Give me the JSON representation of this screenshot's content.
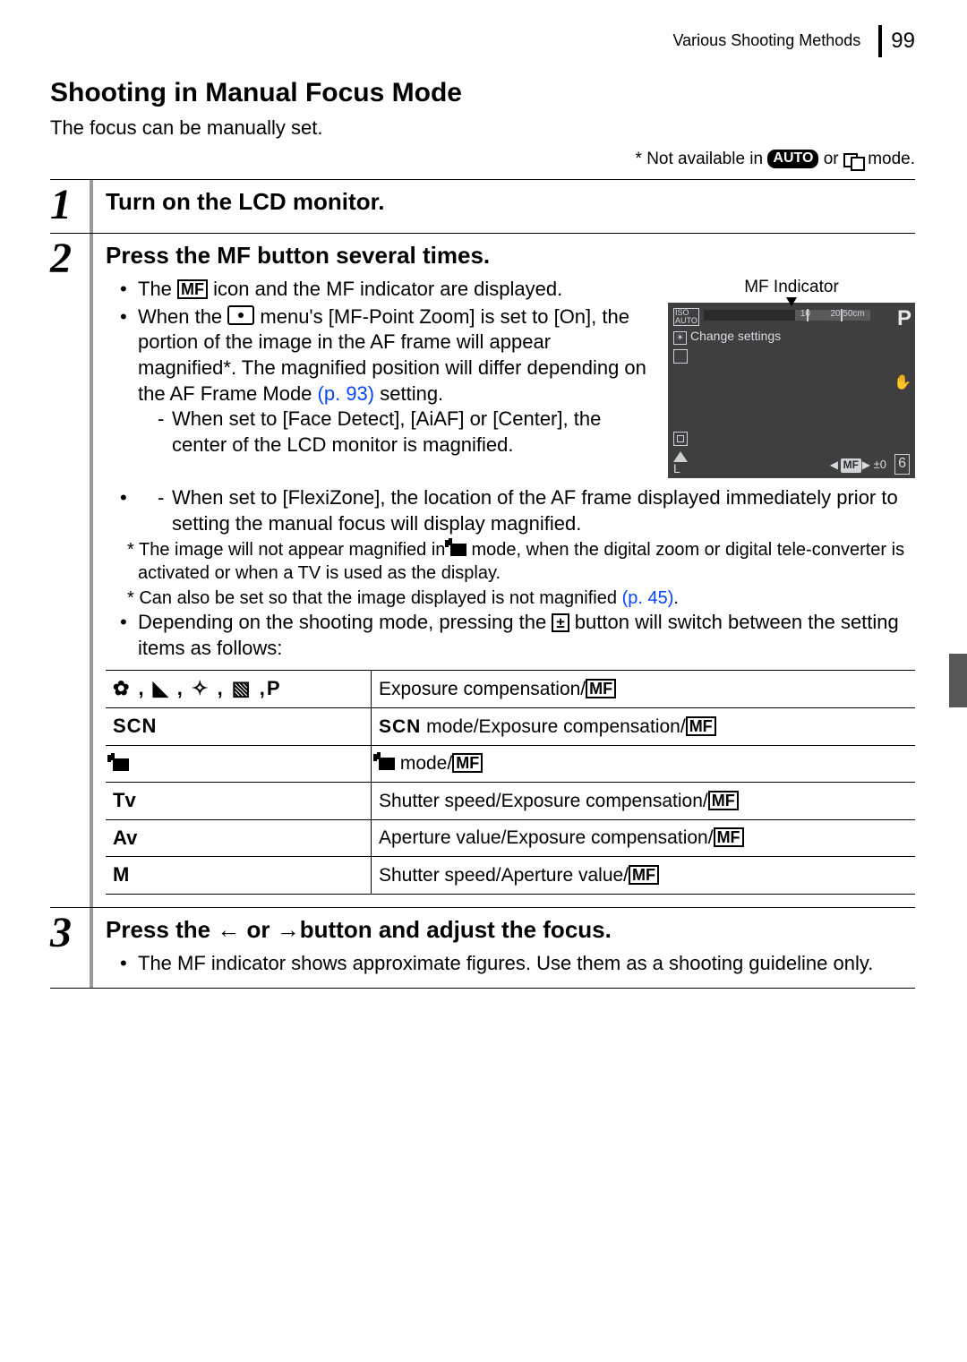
{
  "header": {
    "section": "Various Shooting Methods",
    "page": "99"
  },
  "title": "Shooting in Manual Focus Mode",
  "intro": "The focus can be manually set.",
  "availability": {
    "prefix": "* Not available in ",
    "mid": " or ",
    "suffix": " mode.",
    "auto_badge": "AUTO"
  },
  "step1": {
    "heading": "Turn on the LCD monitor."
  },
  "step2": {
    "heading_pre": "Press the ",
    "heading_mf": "MF",
    "heading_post": " button several times.",
    "b1a": "The ",
    "b1b": " icon and the MF indicator are displayed.",
    "b2a": "When the ",
    "b2b": " menu's [MF-Point Zoom] is set to [On], the portion of the image in the AF frame will appear magnified*. The magnified position will differ depending on the AF Frame Mode ",
    "b2link": "(p. 93)",
    "b2c": " setting.",
    "d1": "When set to [Face Detect], [AiAF] or [Center], the center of the LCD monitor is magnified.",
    "d2": "When set to [FlexiZone], the location of the AF frame displayed immediately prior to setting the manual focus will display magnified.",
    "f1a": "* The image will not appear magnified in ",
    "f1b": " mode, when the digital zoom or digital tele-converter is activated or when a TV is used as the display.",
    "f2a": "* Can also be set so that the image displayed is not magnified ",
    "f2link": "(p. 45)",
    "f2b": ".",
    "b3a": "Depending on the shooting mode, pressing the ",
    "b3b": " button will switch between the setting items as follows:",
    "table": [
      {
        "mode_icons": "creative",
        "desc": "Exposure compensation/",
        "mf": true
      },
      {
        "mode_icons": "scn",
        "desc_pre": "SCN",
        "desc_post": " mode/Exposure compensation/",
        "mf": true
      },
      {
        "mode_icons": "movie",
        "desc_pre_movie": true,
        "desc_post": " mode/",
        "mf": true
      },
      {
        "mode_icons": "tv",
        "desc": "Shutter speed/Exposure compensation/",
        "mf": true
      },
      {
        "mode_icons": "av",
        "desc": "Aperture value/Exposure compensation/",
        "mf": true
      },
      {
        "mode_icons": "m",
        "desc": "Shutter speed/Aperture value/",
        "mf": true
      }
    ]
  },
  "figure": {
    "label": "MF Indicator",
    "iso": "ISO\nAUTO",
    "change": "Change settings",
    "p": "P",
    "scale_10": "10",
    "scale_end": "20 50cm",
    "ev": "±0",
    "mf": "MF",
    "six": "6",
    "hand": "✋",
    "L": "L"
  },
  "step3": {
    "heading_pre": "Press the ",
    "heading_mid": " or ",
    "heading_post": "button and adjust the focus.",
    "b1": "The MF indicator shows approximate figures. Use them as a shooting guideline only."
  },
  "modelabel": {
    "tv": "Tv",
    "av": "Av",
    "m": "M",
    "scn": "SCN",
    "p": "P"
  }
}
